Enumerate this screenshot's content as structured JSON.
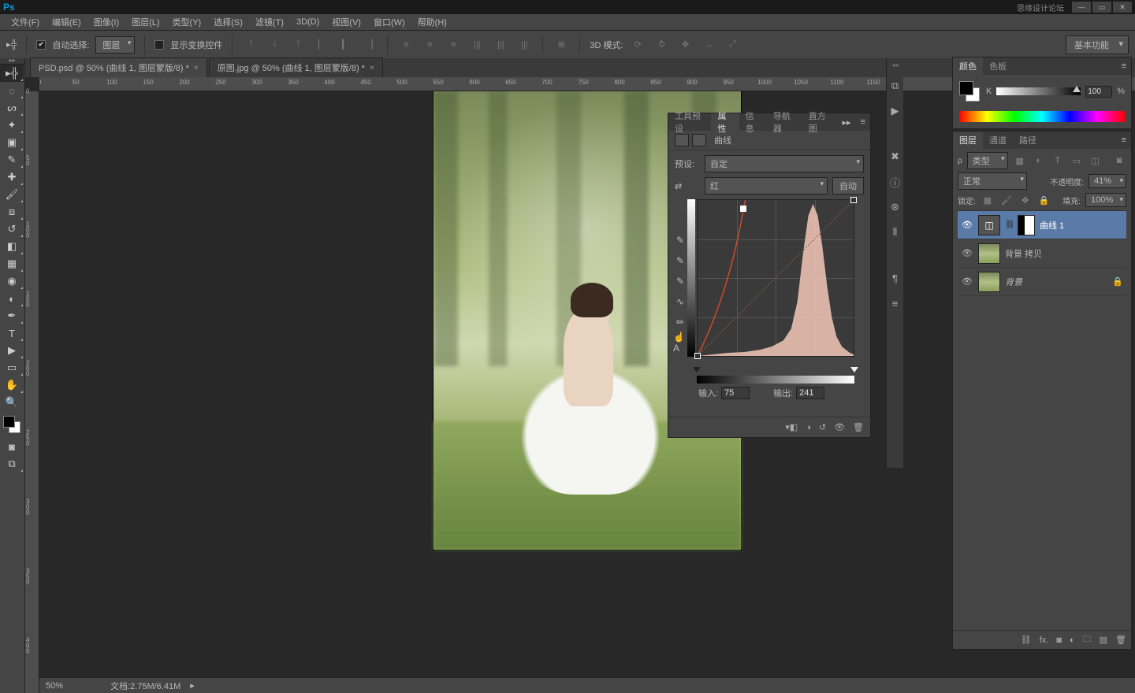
{
  "title": {
    "watermark": "思缘设计论坛"
  },
  "menu": {
    "items": [
      "文件(F)",
      "编辑(E)",
      "图像(I)",
      "图层(L)",
      "类型(Y)",
      "选择(S)",
      "滤镜(T)",
      "3D(D)",
      "视图(V)",
      "窗口(W)",
      "帮助(H)"
    ]
  },
  "options": {
    "autoSelectLabel": "自动选择:",
    "autoSelectTarget": "图层",
    "showTransform": "显示变换控件",
    "mode3d": "3D 模式:",
    "workspace": "基本功能"
  },
  "docs": {
    "tabs": [
      {
        "label": "PSD.psd @ 50% (曲线 1, 图层蒙版/8) *"
      },
      {
        "label": "原图.jpg @ 50% (曲线 1, 图层蒙版/8) *"
      }
    ],
    "active": 1
  },
  "status": {
    "zoom": "50%",
    "doc": "文档:2.75M/6.41M"
  },
  "rulerH": [
    0,
    50,
    100,
    150,
    200,
    250,
    300,
    350,
    400,
    450,
    500,
    550,
    600,
    650,
    700,
    750,
    800,
    850,
    900,
    950,
    1000,
    1050,
    1100,
    1150
  ],
  "rulerV": [
    0,
    50,
    100,
    150,
    200,
    250,
    300,
    350,
    400
  ],
  "propPanel": {
    "tabs": [
      "工具预设",
      "属性",
      "信息",
      "导航器",
      "直方图"
    ],
    "active": 1,
    "title": "曲线",
    "presetLabel": "预设:",
    "presetValue": "自定",
    "channelValue": "红",
    "autoBtn": "自动",
    "inputLabel": "输入:",
    "inputValue": "75",
    "outputLabel": "输出:",
    "outputValue": "241"
  },
  "colorPanel": {
    "tabs": [
      "颜色",
      "色板"
    ],
    "kLabel": "K",
    "kValue": "100",
    "pct": "%"
  },
  "layersPanel": {
    "tabs": [
      "图层",
      "通道",
      "路径"
    ],
    "kind": "类型",
    "blend": "正常",
    "opacityLabel": "不透明度:",
    "opacityValue": "41%",
    "lockLabel": "锁定:",
    "fillLabel": "填充:",
    "fillValue": "100%",
    "layers": [
      {
        "name": "曲线 1",
        "type": "adj",
        "selected": true
      },
      {
        "name": "背景 拷贝",
        "type": "photo"
      },
      {
        "name": "背景",
        "type": "photo",
        "locked": true,
        "italic": true
      }
    ]
  },
  "chart_data": {
    "type": "line",
    "title": "Curves — 红",
    "xlabel": "输入",
    "ylabel": "输出",
    "xlim": [
      0,
      255
    ],
    "ylim": [
      0,
      255
    ],
    "series": [
      {
        "name": "curve",
        "values": [
          [
            0,
            0
          ],
          [
            75,
            241
          ],
          [
            255,
            255
          ]
        ]
      }
    ],
    "histogram_peak_input_range": [
      170,
      230
    ]
  }
}
